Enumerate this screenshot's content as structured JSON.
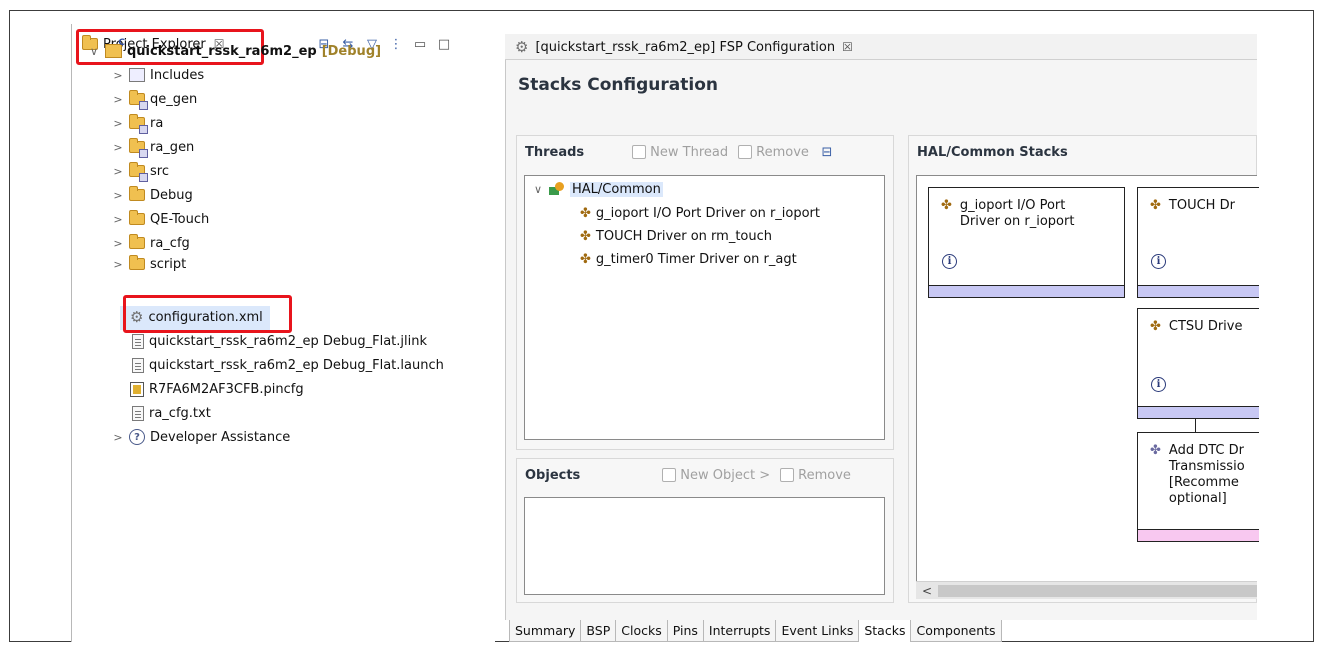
{
  "project_explorer": {
    "tab_label": "Project Explorer",
    "close_glyph": "☒",
    "toolbar_icons": [
      "collapse-all-icon",
      "link-with-editor-icon",
      "filter-icon",
      "view-menu-icon",
      "minimize-icon",
      "maximize-icon"
    ],
    "toolbar_glyphs": [
      "⊟",
      "⇆",
      "▽",
      "⋮",
      "▭",
      "□"
    ],
    "project": {
      "name": "quickstart_rssk_ra6m2_ep",
      "config": "[Debug]",
      "chevron": "∨"
    },
    "items": [
      {
        "label": "Includes",
        "chevron": ">"
      },
      {
        "label": "qe_gen",
        "chevron": ">"
      },
      {
        "label": "ra",
        "chevron": ">"
      },
      {
        "label": "ra_gen",
        "chevron": ">"
      },
      {
        "label": "src",
        "chevron": ">"
      },
      {
        "label": "Debug",
        "chevron": ">"
      },
      {
        "label": "QE-Touch",
        "chevron": ">"
      },
      {
        "label": "ra_cfg",
        "chevron": ">"
      },
      {
        "label": "script",
        "chevron": ">"
      },
      {
        "label": "configuration.xml",
        "chevron": ""
      },
      {
        "label": "quickstart_rssk_ra6m2_ep Debug_Flat.jlink",
        "chevron": ""
      },
      {
        "label": "quickstart_rssk_ra6m2_ep Debug_Flat.launch",
        "chevron": ""
      },
      {
        "label": "R7FA6M2AF3CFB.pincfg",
        "chevron": ""
      },
      {
        "label": "ra_cfg.txt",
        "chevron": ""
      },
      {
        "label": "Developer Assistance",
        "chevron": ">"
      }
    ],
    "help_glyph": "?"
  },
  "editor": {
    "tab_label": "[quickstart_rssk_ra6m2_ep] FSP Configuration",
    "close_glyph": "☒",
    "gear_glyph": "⚙",
    "title": "Stacks Configuration",
    "threads": {
      "title": "Threads",
      "new_thread": "New Thread",
      "remove": "Remove",
      "tree_chevron": "∨",
      "root": "HAL/Common",
      "children": [
        "g_ioport I/O Port Driver on r_ioport",
        "TOUCH Driver on rm_touch",
        "g_timer0 Timer Driver on r_agt"
      ]
    },
    "objects": {
      "title": "Objects",
      "new_object": "New Object >",
      "remove": "Remove"
    },
    "hal_stacks": {
      "title": "HAL/Common Stacks",
      "info_glyph": "i",
      "module_glyph": "✤",
      "cards": [
        {
          "line1": "g_ioport I/O Port",
          "line2": "Driver on r_ioport"
        },
        {
          "line1": "TOUCH Dr",
          "line2": ""
        },
        {
          "line1": "CTSU Drive",
          "line2": ""
        },
        {
          "line1": "Add DTC Dr",
          "line2": "Transmissio",
          "line3": "[Recomme",
          "line4": "optional]"
        }
      ],
      "scroll_left": "<"
    },
    "bottom_tabs": [
      "Summary",
      "BSP",
      "Clocks",
      "Pins",
      "Interrupts",
      "Event Links",
      "Stacks",
      "Components"
    ],
    "active_tab": "Stacks"
  },
  "colors": {
    "highlight_red": "#e8141c",
    "selection": "#dbe8fb",
    "card_bar": "#c8c8f4",
    "card_bar_pink": "#f8c8f0"
  }
}
